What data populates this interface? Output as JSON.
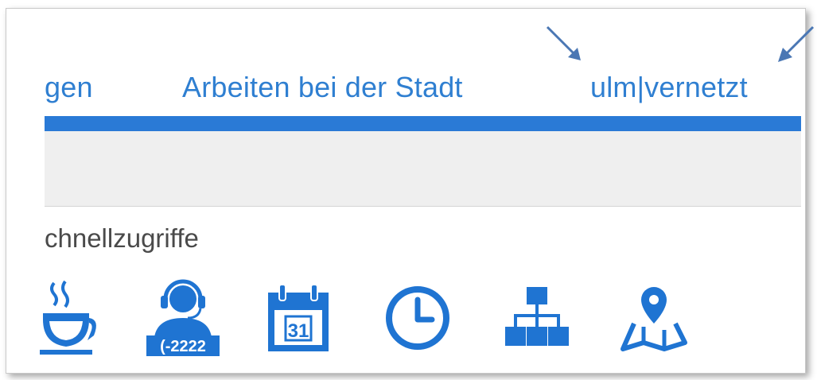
{
  "nav": {
    "items": [
      {
        "label": "gen"
      },
      {
        "label": "Arbeiten bei der Stadt"
      },
      {
        "label": "ulm|vernetzt"
      }
    ]
  },
  "quick_access": {
    "title": "chnellzugriffe",
    "phone_label": "(-2222",
    "calendar_day": "31",
    "icons": [
      "coffee-cup-icon",
      "support-agent-icon",
      "calendar-icon",
      "clock-icon",
      "org-chart-icon",
      "map-pin-icon"
    ]
  },
  "colors": {
    "accent": "#2a7ad6",
    "link": "#2f7fd1",
    "annotation_arrow": "#4a77b4",
    "band": "#efefef"
  }
}
